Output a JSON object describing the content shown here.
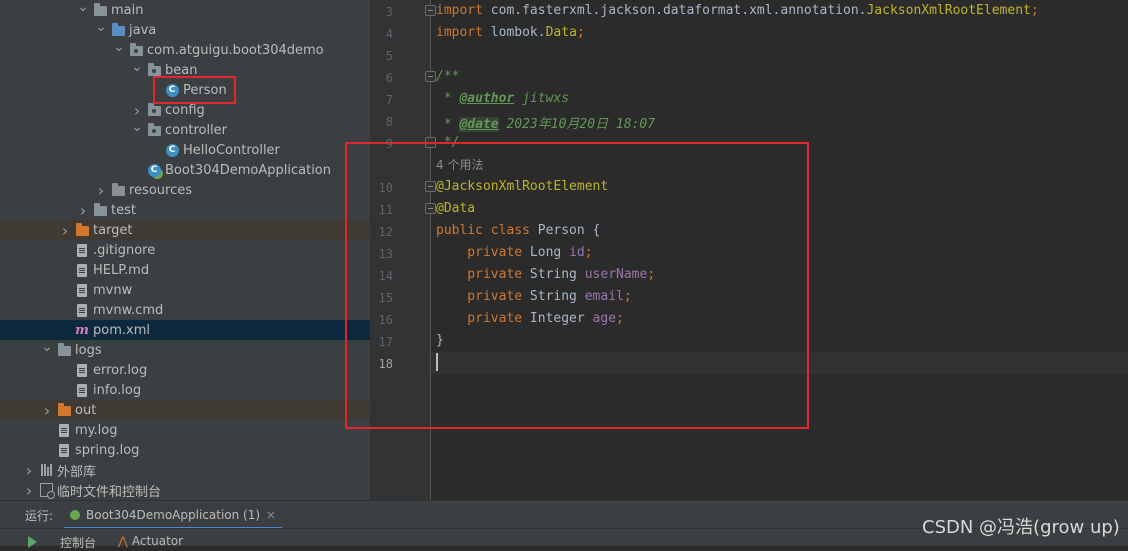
{
  "tree": {
    "items": [
      {
        "label": "main",
        "indent": 5,
        "arrow": "v",
        "icon": "folder"
      },
      {
        "label": "java",
        "indent": 6,
        "arrow": "v",
        "icon": "folder-blue"
      },
      {
        "label": "com.atguigu.boot304demo",
        "indent": 7,
        "arrow": "v",
        "icon": "package"
      },
      {
        "label": "bean",
        "indent": 8,
        "arrow": "v",
        "icon": "package"
      },
      {
        "label": "Person",
        "indent": 9,
        "arrow": "",
        "icon": "class"
      },
      {
        "label": "config",
        "indent": 8,
        "arrow": ">",
        "icon": "package"
      },
      {
        "label": "controller",
        "indent": 8,
        "arrow": "v",
        "icon": "package"
      },
      {
        "label": "HelloController",
        "indent": 9,
        "arrow": "",
        "icon": "class"
      },
      {
        "label": "Boot304DemoApplication",
        "indent": 8,
        "arrow": "",
        "icon": "spring-class"
      },
      {
        "label": "resources",
        "indent": 6,
        "arrow": ">",
        "icon": "folder-res"
      },
      {
        "label": "test",
        "indent": 5,
        "arrow": ">",
        "icon": "folder"
      },
      {
        "label": "target",
        "indent": 4,
        "arrow": ">",
        "icon": "folder-orange",
        "style": "excluded"
      },
      {
        "label": ".gitignore",
        "indent": 4,
        "arrow": "",
        "icon": "file"
      },
      {
        "label": "HELP.md",
        "indent": 4,
        "arrow": "",
        "icon": "file-md"
      },
      {
        "label": "mvnw",
        "indent": 4,
        "arrow": "",
        "icon": "file"
      },
      {
        "label": "mvnw.cmd",
        "indent": 4,
        "arrow": "",
        "icon": "file"
      },
      {
        "label": "pom.xml",
        "indent": 4,
        "arrow": "",
        "icon": "maven",
        "style": "selected"
      },
      {
        "label": "logs",
        "indent": 3,
        "arrow": "v",
        "icon": "folder"
      },
      {
        "label": "error.log",
        "indent": 4,
        "arrow": "",
        "icon": "file"
      },
      {
        "label": "info.log",
        "indent": 4,
        "arrow": "",
        "icon": "file"
      },
      {
        "label": "out",
        "indent": 3,
        "arrow": ">",
        "icon": "folder-orange",
        "style": "excluded"
      },
      {
        "label": "my.log",
        "indent": 3,
        "arrow": "",
        "icon": "file"
      },
      {
        "label": "spring.log",
        "indent": 3,
        "arrow": "",
        "icon": "file"
      },
      {
        "label": "外部库",
        "indent": 2,
        "arrow": ">",
        "icon": "library"
      },
      {
        "label": "临时文件和控制台",
        "indent": 2,
        "arrow": ">",
        "icon": "scratch"
      }
    ]
  },
  "editor": {
    "line_numbers": [
      "3",
      "4",
      "5",
      "6",
      "7",
      "8",
      "9",
      "10",
      "11",
      "12",
      "13",
      "14",
      "15",
      "16",
      "17",
      "18"
    ],
    "current_line": "18",
    "usage_hint": "4 个用法",
    "code": {
      "l3_kw": "import",
      "l3_pkg": " com.fasterxml.jackson.dataformat.xml.annotation.",
      "l3_cls": "JacksonXmlRootElement",
      "l3_end": ";",
      "l4_kw": "import",
      "l4_pkg": " lombok.",
      "l4_cls": "Data",
      "l4_end": ";",
      "l6": "/**",
      "l7_star": " * ",
      "l7_tag": "@author",
      "l7_val": " jitwxs",
      "l8_star": " * ",
      "l8_tag": "@date",
      "l8_val": " 2023年10月20日 18:07",
      "l9": " */",
      "l10": "@JacksonXmlRootElement",
      "l11": "@Data",
      "l12_kw": "public class",
      "l12_rest": " Person {",
      "l13_kw": "    private",
      "l13_type": " Long ",
      "l13_fld": "id",
      "l13_end": ";",
      "l14_kw": "    private",
      "l14_type": " String ",
      "l14_fld": "userName",
      "l14_end": ";",
      "l15_kw": "    private",
      "l15_type": " String ",
      "l15_fld": "email",
      "l15_end": ";",
      "l16_kw": "    private",
      "l16_type": " Integer ",
      "l16_fld": "age",
      "l16_end": ";",
      "l17": "}"
    }
  },
  "run_bar": {
    "label": "运行:",
    "tab": "Boot304DemoApplication (1)",
    "close": "×",
    "console_tab": "控制台",
    "actuator_tab": "Actuator"
  },
  "watermark": "CSDN @冯浩(grow up)",
  "colors": {
    "highlight_box": "#e0272b",
    "keyword": "#cc7832",
    "annotation": "#bbb529",
    "comment": "#629755",
    "field": "#9876aa"
  }
}
